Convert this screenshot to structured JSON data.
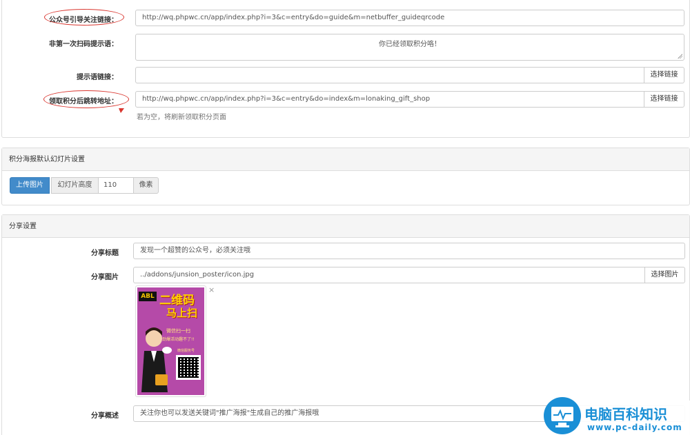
{
  "top": {
    "follow_link": {
      "label": "公众号引导关注链接：",
      "value": "http://wq.phpwc.cn/app/index.php?i=3&c=entry&do=guide&m=netbuffer_guideqrcode"
    },
    "not_first_tip": {
      "label": "非第一次扫码提示语：",
      "value": "你已经领取积分咯！"
    },
    "tip_link": {
      "label": "提示语链接：",
      "value": "",
      "button": "选择链接"
    },
    "redirect": {
      "label": "领取积分后跳转地址：",
      "value": "http://wq.phpwc.cn/app/index.php?i=3&c=entry&do=index&m=lonaking_gift_shop",
      "button": "选择链接",
      "help": "若为空，将刷新领取积分页面"
    }
  },
  "slides": {
    "heading": "积分海报默认幻灯片设置",
    "upload_button": "上传图片",
    "height_label": "幻灯片高度",
    "height_value": "110",
    "unit": "像素"
  },
  "share": {
    "heading": "分享设置",
    "title": {
      "label": "分享标题",
      "value": "发现一个超赞的公众号，必须关注哦"
    },
    "image": {
      "label": "分享图片",
      "value": "../addons/junsion_poster/icon.jpg",
      "button": "选择图片",
      "remove": "×"
    },
    "poster": {
      "brand": "ABL",
      "headline": "二维码",
      "headline2": "马上扫",
      "line1": "微信扫一扫",
      "line2": "劲爆活动趣不了!!",
      "caption": "微信服务号"
    },
    "desc": {
      "label": "分享概述",
      "value": "关注你也可以发送关键词\"推广海报\"生成自己的推广海报哦"
    }
  },
  "watermark": {
    "title": "电脑百科知识",
    "url": "www.pc-daily.com"
  },
  "colors": {
    "accent": "#428bca",
    "annotation": "#d9362f",
    "watermark": "#1a8fd6"
  }
}
